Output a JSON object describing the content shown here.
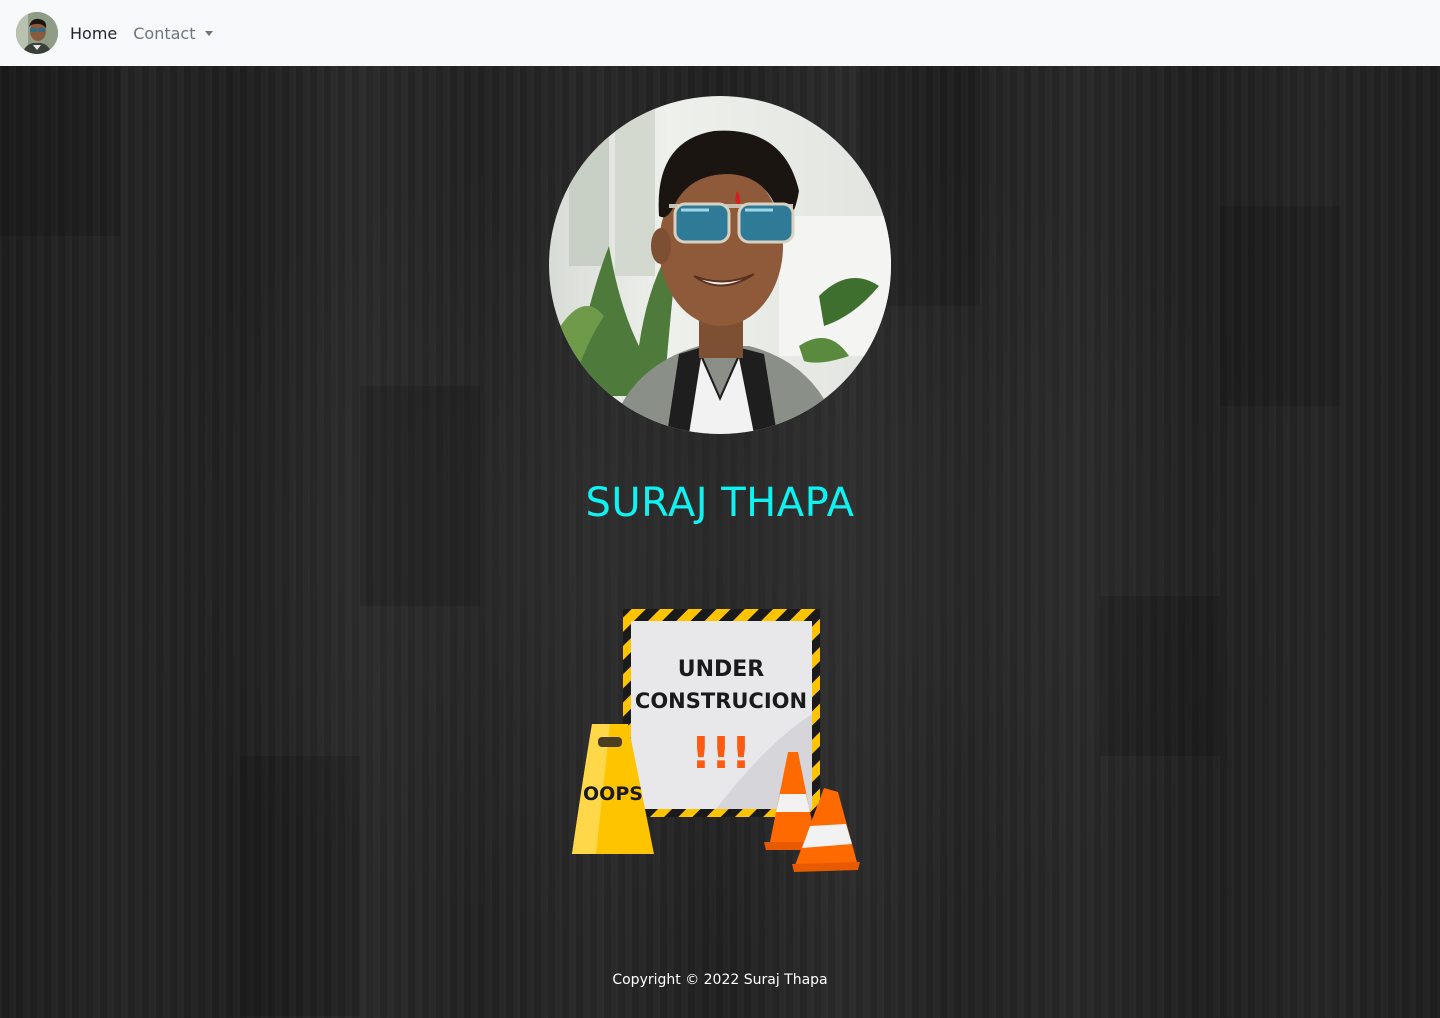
{
  "navbar": {
    "brand_avatar": "profile-avatar",
    "links": [
      {
        "label": "Home"
      },
      {
        "label": "Contact"
      }
    ]
  },
  "hero": {
    "name": "SURAJ THAPA",
    "name_color": "#0ff2f2",
    "illustration": {
      "sign_line1": "UNDER",
      "sign_line2": "CONSTRUCION",
      "sign_exclaim": "!!!",
      "caution_sign_text": "OOPS"
    }
  },
  "footer": {
    "copyright": "Copyright © 2022 Suraj Thapa"
  },
  "colors": {
    "navbar_bg": "#f8f9fa",
    "page_bg": "#262626",
    "accent": "#0ff2f2",
    "caution_yellow": "#ffc400",
    "cone_orange": "#ff6a00"
  }
}
